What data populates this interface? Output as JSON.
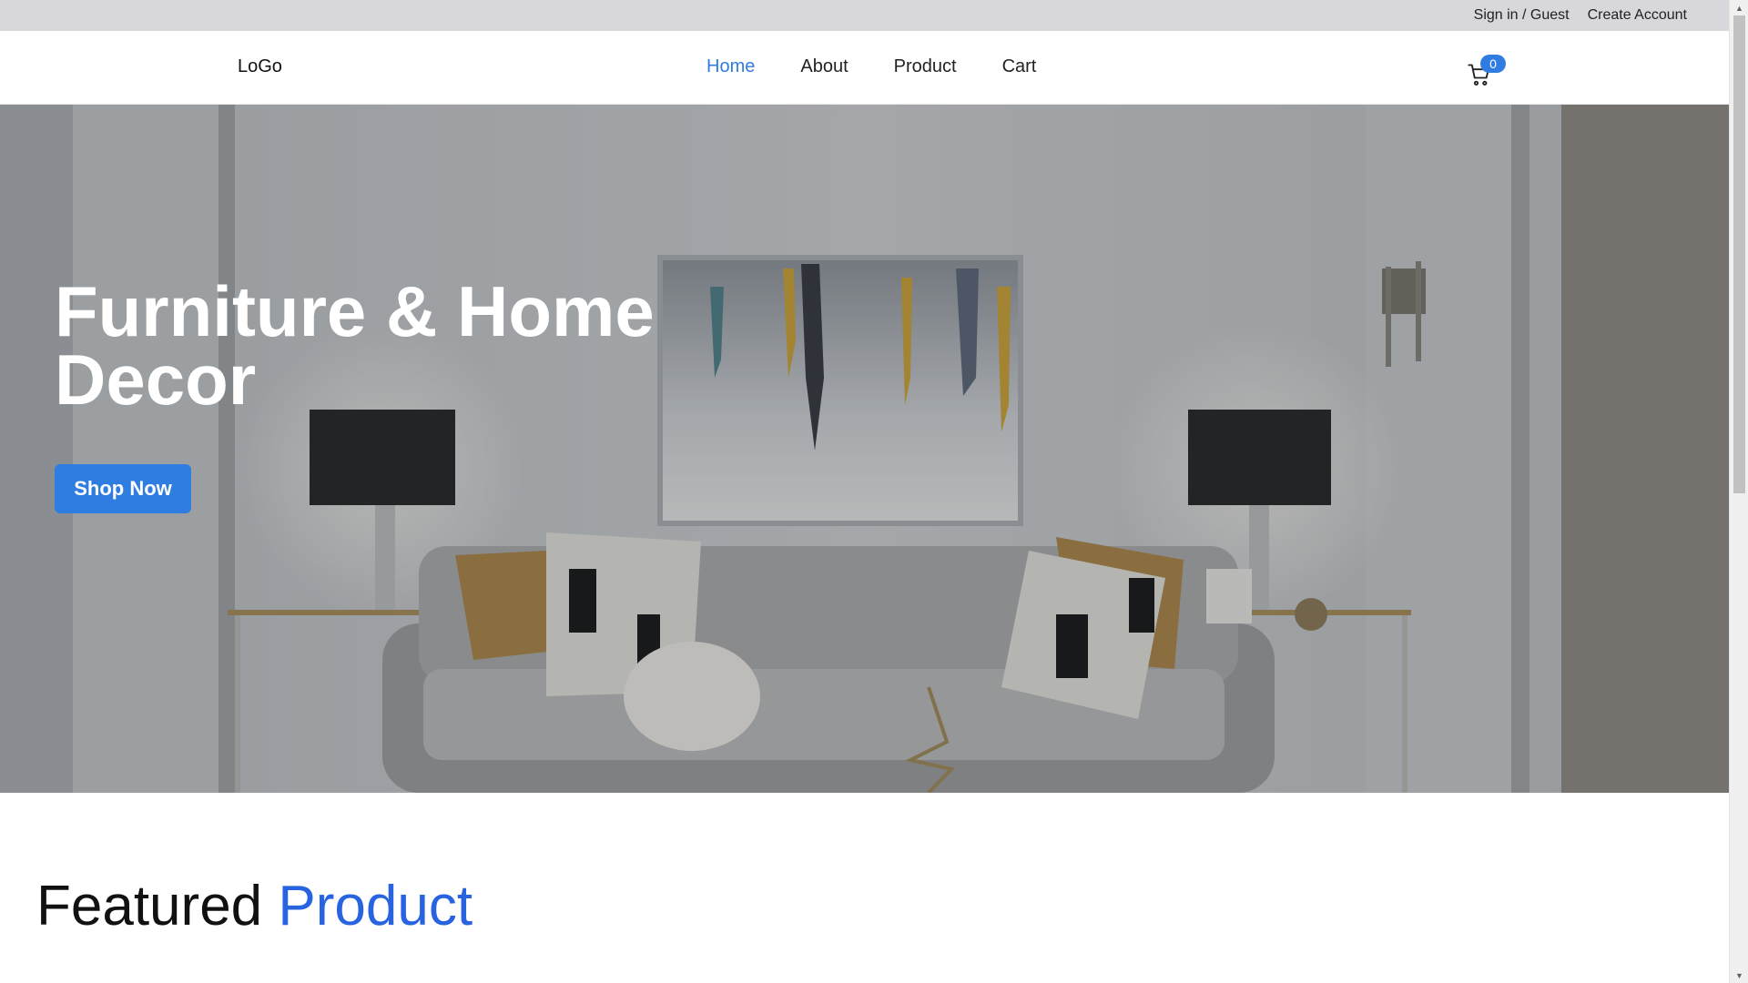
{
  "topbar": {
    "signin_label": "Sign in / Guest",
    "create_account_label": "Create Account"
  },
  "navbar": {
    "logo": "LoGo",
    "links": [
      {
        "label": "Home",
        "active": true
      },
      {
        "label": "About",
        "active": false
      },
      {
        "label": "Product",
        "active": false
      },
      {
        "label": "Cart",
        "active": false
      }
    ],
    "cart_icon": "cart-icon",
    "cart_count": "0"
  },
  "hero": {
    "title_line1": "Furniture & Home",
    "title_line2": "Decor",
    "button_label": "Shop Now"
  },
  "featured": {
    "heading_part1": "Featured",
    "heading_part2": "Product"
  },
  "colors": {
    "accent": "#2f7de1",
    "topbar_bg": "#d7d7dc",
    "heading_accent": "#2863e0"
  }
}
